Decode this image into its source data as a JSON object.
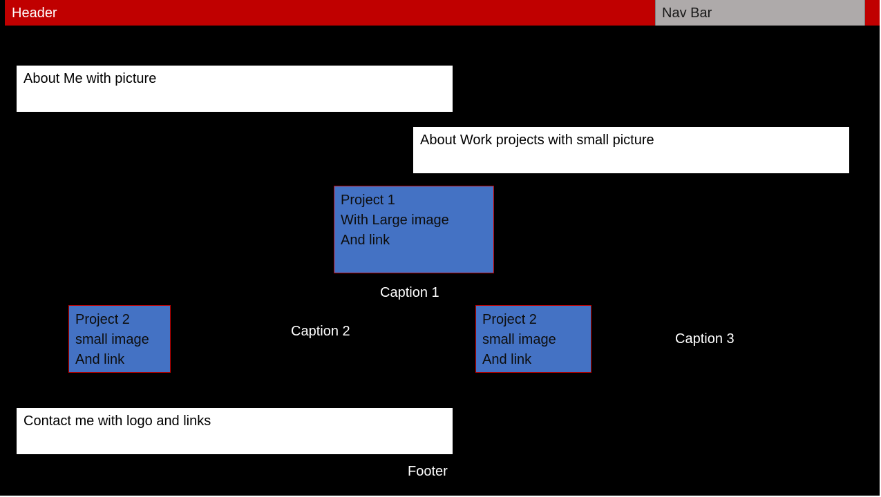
{
  "header": {
    "label": "Header",
    "color": "#c00000"
  },
  "nav": {
    "label": "Nav Bar",
    "color": "#aeaaaa"
  },
  "sections": {
    "about_me": "About Me with picture",
    "about_work": "About Work projects with small picture",
    "contact": "Contact me with logo and links"
  },
  "projects": [
    {
      "line1": "Project 1",
      "line2": "With Large image",
      "line3": "And link",
      "caption": "Caption 1"
    },
    {
      "line1": "Project 2",
      "line2": "small image",
      "line3": "And link",
      "caption": "Caption 2"
    },
    {
      "line1": "Project 2",
      "line2": "small image",
      "line3": "And link",
      "caption": "Caption 3"
    }
  ],
  "footer": {
    "label": "Footer"
  },
  "colors": {
    "background": "#000000",
    "project_fill": "#4472c4",
    "project_border": "#c00000"
  }
}
